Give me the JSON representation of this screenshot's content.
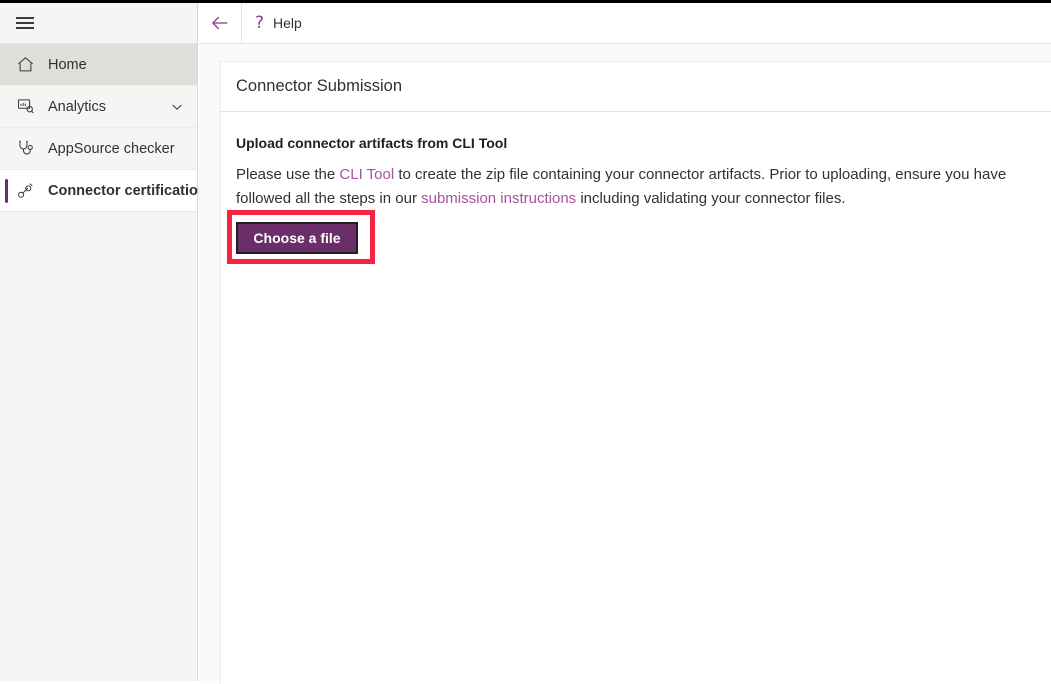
{
  "window": {
    "top_strip_color": "#000000"
  },
  "sidebar": {
    "menu_icon": "hamburger-icon",
    "items": [
      {
        "label": "Home",
        "icon": "home-icon",
        "state": "selected",
        "expandable": false
      },
      {
        "label": "Analytics",
        "icon": "analytics-icon",
        "state": "normal",
        "expandable": true
      },
      {
        "label": "AppSource checker",
        "icon": "stethoscope-icon",
        "state": "normal",
        "expandable": false
      },
      {
        "label": "Connector certification",
        "icon": "connector-icon",
        "state": "active",
        "expandable": false
      }
    ]
  },
  "command_bar": {
    "back_icon": "back-arrow-icon",
    "help_icon": "question-mark-icon",
    "help_label": "Help"
  },
  "main": {
    "card_title": "Connector Submission",
    "section_title": "Upload connector artifacts from CLI Tool",
    "description": {
      "part1": "Please use the ",
      "link1": "CLI Tool",
      "part2": " to create the zip file containing your connector artifacts. Prior to uploading, ensure you have followed all the steps in our ",
      "link2": "submission instructions",
      "part3": " including validating your connector files."
    },
    "choose_file_button": "Choose a file"
  },
  "colors": {
    "accent_purple": "#742774",
    "button_purple": "#6b2e6b",
    "link_purple": "#a8529f",
    "highlight_red": "#f5253f",
    "sidebar_bg": "#f5f5f3",
    "page_bg": "#faf9f8"
  }
}
